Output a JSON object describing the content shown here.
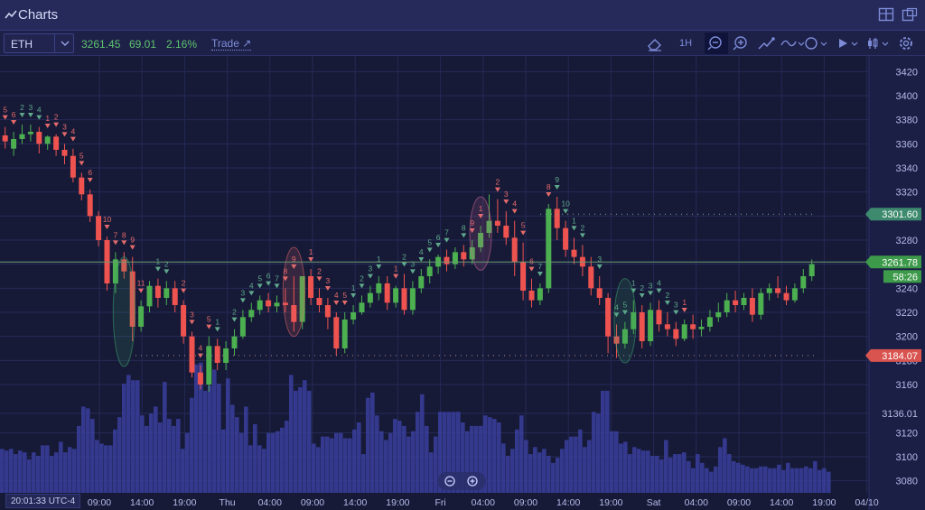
{
  "window": {
    "title": "Charts"
  },
  "toolbar": {
    "symbol": "ETH",
    "last_price": "3261.45",
    "change": "69.01",
    "change_pct": "2.16%",
    "trade_label": "Trade",
    "timeframe": "1H"
  },
  "status": {
    "timestamp": "20:01:33 UTC-4"
  },
  "colors": {
    "up": "#4caf50",
    "down": "#ef5350",
    "volume": "#3a3f9e",
    "background": "#161a37",
    "accent": "#7e8cd8"
  },
  "chart_data": {
    "type": "candlestick",
    "symbol": "ETH",
    "ylim": [
      3070,
      3430
    ],
    "y_ticks": [
      3420,
      3400,
      3380,
      3360,
      3340,
      3320,
      3300,
      3280,
      3260,
      3240,
      3220,
      3200,
      3180,
      3160,
      3136.01,
      3120,
      3100,
      3080
    ],
    "x_tick_labels": [
      "09:00",
      "14:00",
      "19:00",
      "Thu",
      "04:00",
      "09:00",
      "14:00",
      "19:00",
      "Fri",
      "04:00",
      "09:00",
      "14:00",
      "19:00",
      "Sat",
      "04:00",
      "09:00",
      "14:00",
      "19:00",
      "04/10"
    ],
    "price_labels": [
      {
        "value": 3301.6,
        "label": "3301.60",
        "color": "#3d8a6e"
      },
      {
        "value": 3261.78,
        "label": "3261.78",
        "color": "#3d9a4a"
      },
      {
        "value": 3184.07,
        "label": "3184.07",
        "color": "#d9534f"
      }
    ],
    "countdown": "58:26",
    "candles": [
      [
        3367,
        3374,
        3362,
        3356
      ],
      [
        3356,
        3370,
        3364,
        3350
      ],
      [
        3364,
        3376,
        3368,
        3360
      ],
      [
        3368,
        3376,
        3370,
        3362
      ],
      [
        3370,
        3374,
        3360,
        3352
      ],
      [
        3360,
        3367,
        3366,
        3355
      ],
      [
        3366,
        3368,
        3355,
        3350
      ],
      [
        3355,
        3360,
        3350,
        3343
      ],
      [
        3350,
        3356,
        3332,
        3328
      ],
      [
        3332,
        3336,
        3318,
        3313
      ],
      [
        3318,
        3322,
        3300,
        3295
      ],
      [
        3300,
        3304,
        3280,
        3275
      ],
      [
        3280,
        3283,
        3244,
        3238
      ],
      [
        3244,
        3270,
        3264,
        3236
      ],
      [
        3264,
        3270,
        3254,
        3248
      ],
      [
        3254,
        3266,
        3208,
        3196
      ],
      [
        3208,
        3230,
        3225,
        3204
      ],
      [
        3225,
        3246,
        3242,
        3220
      ],
      [
        3242,
        3248,
        3232,
        3224
      ],
      [
        3232,
        3246,
        3240,
        3226
      ],
      [
        3240,
        3246,
        3226,
        3220
      ],
      [
        3226,
        3230,
        3200,
        3194
      ],
      [
        3200,
        3204,
        3170,
        3166
      ],
      [
        3170,
        3176,
        3160,
        3156
      ],
      [
        3160,
        3200,
        3192,
        3154
      ],
      [
        3192,
        3198,
        3178,
        3172
      ],
      [
        3178,
        3196,
        3190,
        3172
      ],
      [
        3190,
        3206,
        3200,
        3184
      ],
      [
        3200,
        3222,
        3216,
        3198
      ],
      [
        3216,
        3228,
        3222,
        3212
      ],
      [
        3222,
        3234,
        3230,
        3218
      ],
      [
        3230,
        3236,
        3225,
        3220
      ],
      [
        3225,
        3234,
        3228,
        3220
      ],
      [
        3228,
        3240,
        3226,
        3220
      ],
      [
        3226,
        3250,
        3212,
        3204
      ],
      [
        3212,
        3234,
        3250,
        3206
      ],
      [
        3250,
        3256,
        3232,
        3226
      ],
      [
        3232,
        3240,
        3226,
        3220
      ],
      [
        3226,
        3232,
        3216,
        3206
      ],
      [
        3216,
        3220,
        3190,
        3184
      ],
      [
        3190,
        3220,
        3214,
        3186
      ],
      [
        3214,
        3226,
        3220,
        3210
      ],
      [
        3220,
        3234,
        3228,
        3218
      ],
      [
        3228,
        3242,
        3236,
        3224
      ],
      [
        3236,
        3250,
        3244,
        3230
      ],
      [
        3244,
        3250,
        3228,
        3222
      ],
      [
        3228,
        3242,
        3240,
        3224
      ],
      [
        3240,
        3252,
        3222,
        3218
      ],
      [
        3222,
        3246,
        3240,
        3218
      ],
      [
        3240,
        3256,
        3250,
        3236
      ],
      [
        3250,
        3264,
        3258,
        3244
      ],
      [
        3258,
        3268,
        3266,
        3252
      ],
      [
        3266,
        3272,
        3260,
        3254
      ],
      [
        3260,
        3274,
        3270,
        3256
      ],
      [
        3270,
        3276,
        3264,
        3258
      ],
      [
        3264,
        3280,
        3274,
        3260
      ],
      [
        3274,
        3292,
        3286,
        3270
      ],
      [
        3286,
        3318,
        3296,
        3282
      ],
      [
        3296,
        3314,
        3292,
        3286
      ],
      [
        3292,
        3304,
        3282,
        3276
      ],
      [
        3282,
        3296,
        3262,
        3250
      ],
      [
        3262,
        3278,
        3238,
        3230
      ],
      [
        3238,
        3248,
        3230,
        3224
      ],
      [
        3230,
        3244,
        3240,
        3226
      ],
      [
        3240,
        3310,
        3306,
        3236
      ],
      [
        3306,
        3316,
        3290,
        3280
      ],
      [
        3290,
        3296,
        3272,
        3266
      ],
      [
        3272,
        3282,
        3266,
        3260
      ],
      [
        3266,
        3276,
        3258,
        3250
      ],
      [
        3258,
        3266,
        3240,
        3234
      ],
      [
        3240,
        3250,
        3232,
        3226
      ],
      [
        3232,
        3236,
        3200,
        3186
      ],
      [
        3200,
        3210,
        3194,
        3182
      ],
      [
        3194,
        3212,
        3206,
        3190
      ],
      [
        3206,
        3230,
        3220,
        3202
      ],
      [
        3220,
        3226,
        3196,
        3190
      ],
      [
        3196,
        3228,
        3222,
        3192
      ],
      [
        3222,
        3230,
        3210,
        3204
      ],
      [
        3210,
        3220,
        3206,
        3200
      ],
      [
        3206,
        3212,
        3198,
        3192
      ],
      [
        3198,
        3214,
        3210,
        3196
      ],
      [
        3210,
        3218,
        3206,
        3198
      ],
      [
        3206,
        3214,
        3208,
        3200
      ],
      [
        3208,
        3222,
        3216,
        3204
      ],
      [
        3216,
        3228,
        3220,
        3212
      ],
      [
        3220,
        3236,
        3230,
        3216
      ],
      [
        3230,
        3238,
        3226,
        3220
      ],
      [
        3226,
        3236,
        3232,
        3222
      ],
      [
        3232,
        3240,
        3218,
        3212
      ],
      [
        3218,
        3240,
        3236,
        3214
      ],
      [
        3236,
        3244,
        3240,
        3230
      ],
      [
        3240,
        3250,
        3236,
        3232
      ],
      [
        3236,
        3242,
        3230,
        3226
      ],
      [
        3230,
        3244,
        3240,
        3228
      ],
      [
        3240,
        3256,
        3250,
        3236
      ],
      [
        3250,
        3264,
        3260,
        3246
      ]
    ],
    "volume": [
      25,
      24,
      25,
      22,
      24,
      23,
      19,
      23,
      21,
      27,
      27,
      21,
      23,
      29,
      23,
      26,
      25,
      38,
      49,
      48,
      42,
      30,
      28,
      27,
      27,
      36,
      43,
      62,
      67,
      64,
      64,
      44,
      38,
      45,
      49,
      40,
      63,
      42,
      38,
      42,
      25,
      34,
      54,
      73,
      74,
      58,
      61,
      70,
      62,
      36,
      65,
      50,
      43,
      34,
      49,
      27,
      39,
      27,
      25,
      34,
      34,
      35,
      37,
      41,
      67,
      58,
      60,
      64,
      58,
      28,
      26,
      32,
      32,
      31,
      34,
      34,
      31,
      31,
      36,
      40,
      22,
      54,
      57,
      44,
      35,
      30,
      34,
      42,
      41,
      38,
      32,
      35,
      46,
      56,
      38,
      23,
      32,
      46,
      46,
      46,
      46,
      46,
      40,
      35,
      38,
      38,
      38,
      44,
      43,
      42,
      40,
      28,
      21,
      25,
      36,
      44,
      30,
      22,
      26,
      23,
      25,
      21,
      17,
      20,
      25,
      30,
      32,
      32,
      36,
      26,
      30,
      46,
      45,
      58,
      58,
      35,
      35,
      28,
      29,
      22,
      26,
      25,
      24,
      24,
      21,
      21,
      19,
      30,
      20,
      22,
      22,
      23,
      18,
      14,
      22,
      17,
      14,
      12,
      15,
      26,
      31,
      22,
      18,
      17,
      16,
      15,
      14,
      14,
      15,
      15,
      14,
      14,
      16,
      13,
      17,
      14,
      14,
      14,
      15,
      14,
      18,
      13,
      14,
      12
    ],
    "annotations": [
      {
        "i": 0,
        "n": "5",
        "dir": "down"
      },
      {
        "i": 1,
        "n": "6",
        "dir": "down"
      },
      {
        "i": 2,
        "n": "2",
        "dir": "up"
      },
      {
        "i": 3,
        "n": "3",
        "dir": "up"
      },
      {
        "i": 4,
        "n": "4",
        "dir": "up"
      },
      {
        "i": 5,
        "n": "1",
        "dir": "down"
      },
      {
        "i": 6,
        "n": "2",
        "dir": "down"
      },
      {
        "i": 7,
        "n": "3",
        "dir": "down"
      },
      {
        "i": 8,
        "n": "4",
        "dir": "down"
      },
      {
        "i": 9,
        "n": "5",
        "dir": "down"
      },
      {
        "i": 10,
        "n": "6",
        "dir": "down"
      },
      {
        "i": 12,
        "n": "10",
        "dir": "down"
      },
      {
        "i": 13,
        "n": "7",
        "dir": "down"
      },
      {
        "i": 14,
        "n": "8",
        "dir": "down"
      },
      {
        "i": 15,
        "n": "9",
        "dir": "down"
      },
      {
        "i": 16,
        "n": "11",
        "dir": "down"
      },
      {
        "i": 18,
        "n": "1",
        "dir": "up"
      },
      {
        "i": 19,
        "n": "2",
        "dir": "up"
      },
      {
        "i": 21,
        "n": "2",
        "dir": "down"
      },
      {
        "i": 22,
        "n": "3",
        "dir": "down"
      },
      {
        "i": 23,
        "n": "4",
        "dir": "down"
      },
      {
        "i": 24,
        "n": "5",
        "dir": "down"
      },
      {
        "i": 25,
        "n": "1",
        "dir": "up"
      },
      {
        "i": 27,
        "n": "2",
        "dir": "up"
      },
      {
        "i": 28,
        "n": "3",
        "dir": "up"
      },
      {
        "i": 29,
        "n": "4",
        "dir": "up"
      },
      {
        "i": 30,
        "n": "5",
        "dir": "up"
      },
      {
        "i": 31,
        "n": "6",
        "dir": "up"
      },
      {
        "i": 32,
        "n": "7",
        "dir": "up"
      },
      {
        "i": 33,
        "n": "8",
        "dir": "down"
      },
      {
        "i": 34,
        "n": "9",
        "dir": "down"
      },
      {
        "i": 36,
        "n": "1",
        "dir": "down"
      },
      {
        "i": 37,
        "n": "2",
        "dir": "down"
      },
      {
        "i": 38,
        "n": "3",
        "dir": "down"
      },
      {
        "i": 39,
        "n": "4",
        "dir": "down"
      },
      {
        "i": 40,
        "n": "5",
        "dir": "down"
      },
      {
        "i": 41,
        "n": "1",
        "dir": "up"
      },
      {
        "i": 42,
        "n": "2",
        "dir": "up"
      },
      {
        "i": 43,
        "n": "3",
        "dir": "up"
      },
      {
        "i": 44,
        "n": "1",
        "dir": "up"
      },
      {
        "i": 46,
        "n": "1",
        "dir": "down"
      },
      {
        "i": 47,
        "n": "2",
        "dir": "up"
      },
      {
        "i": 48,
        "n": "3",
        "dir": "up"
      },
      {
        "i": 49,
        "n": "4",
        "dir": "up"
      },
      {
        "i": 50,
        "n": "5",
        "dir": "up"
      },
      {
        "i": 51,
        "n": "6",
        "dir": "up"
      },
      {
        "i": 52,
        "n": "7",
        "dir": "up"
      },
      {
        "i": 54,
        "n": "8",
        "dir": "up"
      },
      {
        "i": 55,
        "n": "9",
        "dir": "down"
      },
      {
        "i": 56,
        "n": "1",
        "dir": "down"
      },
      {
        "i": 58,
        "n": "2",
        "dir": "down"
      },
      {
        "i": 59,
        "n": "3",
        "dir": "down"
      },
      {
        "i": 60,
        "n": "4",
        "dir": "down"
      },
      {
        "i": 61,
        "n": "5",
        "dir": "down"
      },
      {
        "i": 62,
        "n": "6",
        "dir": "down"
      },
      {
        "i": 63,
        "n": "7",
        "dir": "up"
      },
      {
        "i": 64,
        "n": "8",
        "dir": "down"
      },
      {
        "i": 65,
        "n": "9",
        "dir": "up"
      },
      {
        "i": 66,
        "n": "10",
        "dir": "up"
      },
      {
        "i": 67,
        "n": "1",
        "dir": "up"
      },
      {
        "i": 68,
        "n": "2",
        "dir": "up"
      },
      {
        "i": 70,
        "n": "3",
        "dir": "up"
      },
      {
        "i": 72,
        "n": "4",
        "dir": "up"
      },
      {
        "i": 73,
        "n": "5",
        "dir": "up"
      },
      {
        "i": 74,
        "n": "1",
        "dir": "up"
      },
      {
        "i": 75,
        "n": "2",
        "dir": "up"
      },
      {
        "i": 76,
        "n": "3",
        "dir": "up"
      },
      {
        "i": 77,
        "n": "4",
        "dir": "up"
      },
      {
        "i": 78,
        "n": "2",
        "dir": "up"
      },
      {
        "i": 79,
        "n": "3",
        "dir": "up"
      },
      {
        "i": 80,
        "n": "1",
        "dir": "down"
      }
    ]
  }
}
